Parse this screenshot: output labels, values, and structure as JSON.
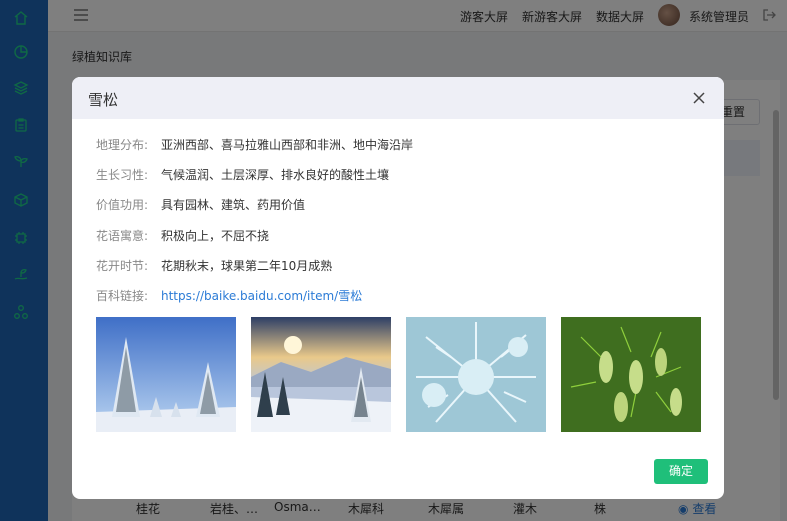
{
  "header": {
    "nav": [
      "游客大屏",
      "新游客大屏",
      "数据大屏"
    ],
    "user_name": "系统管理员"
  },
  "breadcrumb": "绿植知识库",
  "toolbar": {
    "reset_label": "重置"
  },
  "table": {
    "visible_row": [
      "桂花",
      "岩桂、…",
      "Osma…",
      "木犀科",
      "木犀属",
      "灌木",
      "株"
    ],
    "view_label": "查看"
  },
  "dialog": {
    "title": "雪松",
    "fields": [
      {
        "label": "地理分布:",
        "value": "亚洲西部、喜马拉雅山西部和非洲、地中海沿岸"
      },
      {
        "label": "生长习性:",
        "value": "气候温润、土层深厚、排水良好的酸性土壤"
      },
      {
        "label": "价值功用:",
        "value": "具有园林、建筑、药用价值"
      },
      {
        "label": "花语寓意:",
        "value": "积极向上，不屈不挠"
      },
      {
        "label": "花开时节:",
        "value": "花期秋末，球果第二年10月成熟"
      },
      {
        "label": "百科链接:",
        "value": "https://baike.baidu.com/item/雪松"
      }
    ],
    "confirm_label": "确定"
  },
  "colors": {
    "sidebar": "#1f67b7",
    "accent": "#1fbf7a",
    "link": "#2b7bd6"
  }
}
